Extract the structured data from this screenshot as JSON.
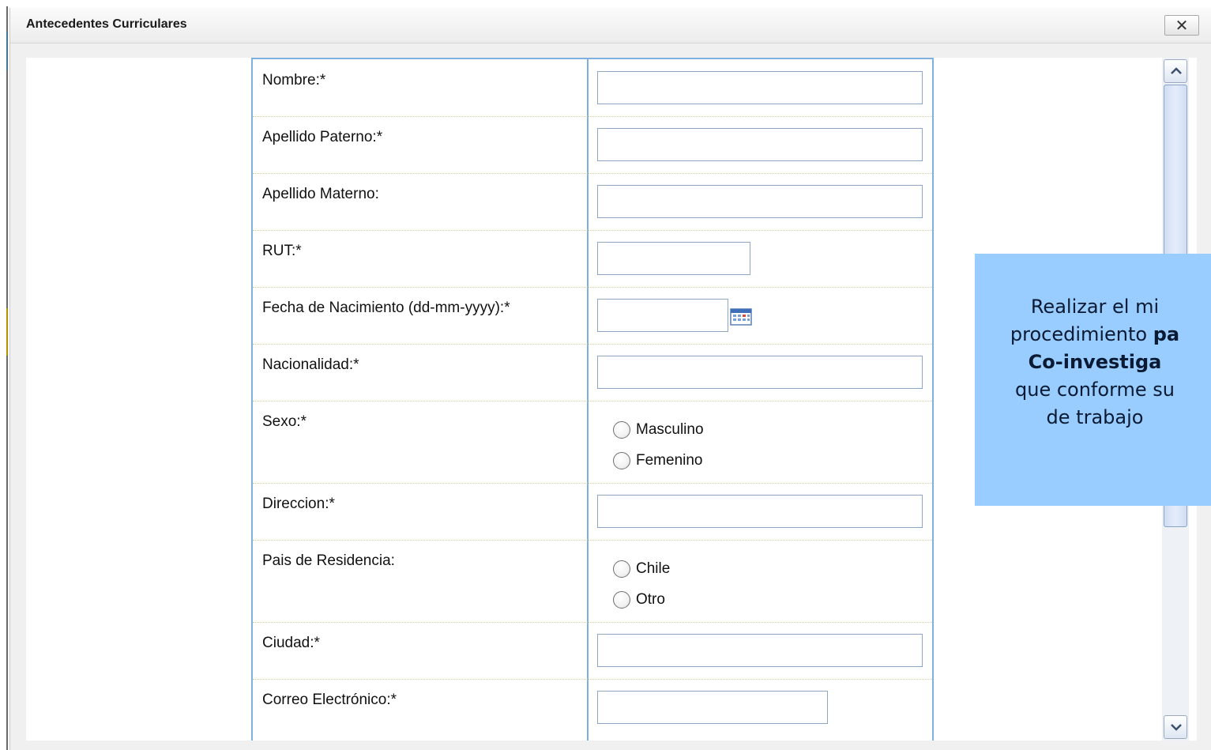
{
  "dialog": {
    "title": "Antecedentes Curriculares",
    "close_label": "✕"
  },
  "form": {
    "fields": [
      {
        "label": "Nombre:*",
        "type": "text",
        "value": ""
      },
      {
        "label": "Apellido Paterno:*",
        "type": "text",
        "value": ""
      },
      {
        "label": "Apellido Materno:",
        "type": "text",
        "value": ""
      },
      {
        "label": "RUT:*",
        "type": "text",
        "value": ""
      },
      {
        "label": "Fecha de Nacimiento (dd-mm-yyyy):*",
        "type": "date",
        "value": ""
      },
      {
        "label": "Nacionalidad:*",
        "type": "text",
        "value": ""
      },
      {
        "label": "Sexo:*",
        "type": "radio",
        "options": [
          "Masculino",
          "Femenino"
        ]
      },
      {
        "label": "Direccion:*",
        "type": "text",
        "value": ""
      },
      {
        "label": "Pais de Residencia:",
        "type": "radio",
        "options": [
          "Chile",
          "Otro"
        ]
      },
      {
        "label": "Ciudad:*",
        "type": "text",
        "value": ""
      },
      {
        "label": "Correo Electrónico:*",
        "type": "text",
        "value": ""
      }
    ]
  },
  "callout": {
    "line1": "Realizar el mi",
    "line2_a": "procedimiento ",
    "line2_b": "pa",
    "line3": "Co-investiga",
    "line4": "que conforme su",
    "line5": "de trabajo"
  },
  "icons": {
    "close": "close-icon",
    "calendar": "calendar-icon",
    "scroll_up": "chevron-up-icon",
    "scroll_down": "chevron-down-icon"
  },
  "colors": {
    "table_border": "#7fb0df",
    "callout_bg": "#99ccff"
  }
}
